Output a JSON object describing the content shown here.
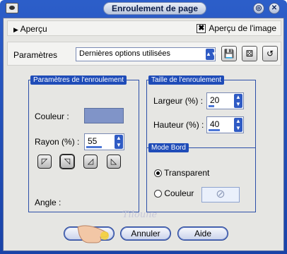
{
  "window": {
    "title": "Enroulement de page",
    "minimize_glyph": "◎",
    "close_glyph": "✕"
  },
  "apercu": {
    "label": "Aperçu",
    "arrow_glyph": "▶",
    "image_label": "Aperçu de l'image",
    "image_checked": true,
    "check_glyph": "✖"
  },
  "params": {
    "label": "Paramètres",
    "value": "Dernières options utilisées",
    "save_icon": "save-icon",
    "dice_icon": "dice-icon",
    "reset_icon": "reset-icon"
  },
  "enroulement": {
    "header": "Paramètres de l'enroulement",
    "couleur_label": "Couleur :",
    "couleur_value": "#8094c8",
    "rayon_label": "Rayon (%) :",
    "rayon_value": "55",
    "angle_label": "Angle :"
  },
  "taille": {
    "header": "Taille de l'enroulement",
    "largeur_label": "Largeur (%) :",
    "largeur_value": "20",
    "hauteur_label": "Hauteur (%) :",
    "hauteur_value": "40"
  },
  "mode": {
    "header": "Mode Bord",
    "transparent_label": "Transparent",
    "couleur_label": "Couleur",
    "selected": "Transparent",
    "no_color_glyph": "⃠"
  },
  "buttons": {
    "ok": "OK",
    "annuler": "Annuler",
    "aide": "Aide"
  },
  "watermark": "Tiloune"
}
